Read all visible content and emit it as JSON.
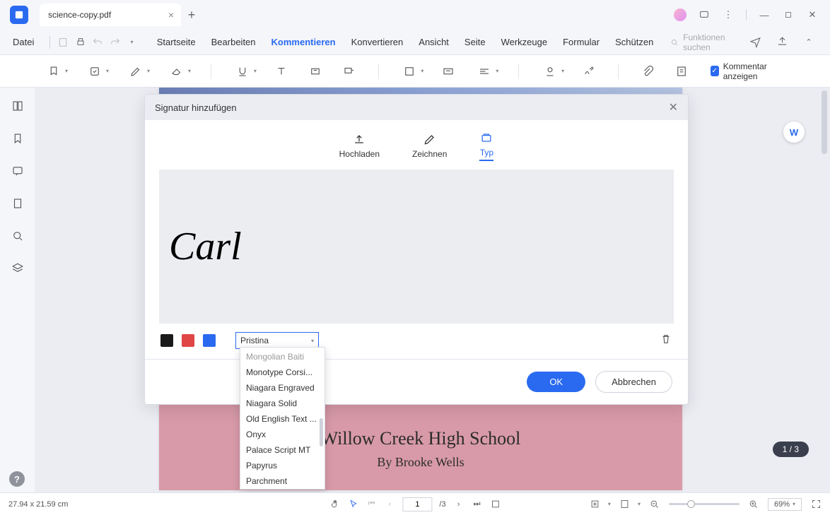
{
  "titlebar": {
    "tab_title": "science-copy.pdf"
  },
  "menu": {
    "file": "Datei",
    "items": [
      "Startseite",
      "Bearbeiten",
      "Kommentieren",
      "Konvertieren",
      "Ansicht",
      "Seite",
      "Werkzeuge",
      "Formular",
      "Schützen"
    ],
    "active_index": 2,
    "search_placeholder": "Funktionen suchen"
  },
  "toolbar": {
    "comment_label": "Kommentar anzeigen",
    "comment_checked": true
  },
  "dialog": {
    "title": "Signatur hinzufügen",
    "tabs": {
      "upload": "Hochladen",
      "draw": "Zeichnen",
      "type": "Typ"
    },
    "signature_text": "Carl",
    "font_selected": "Pristina",
    "font_options": [
      "Mongolian Baiti",
      "Monotype Corsi...",
      "Niagara Engraved",
      "Niagara Solid",
      "Old English Text ...",
      "Onyx",
      "Palace Script MT",
      "Papyrus",
      "Parchment"
    ],
    "ok": "OK",
    "cancel": "Abbrechen",
    "colors": {
      "black": "#1a1a1a",
      "red": "#e04646",
      "blue": "#2a6af0"
    }
  },
  "document": {
    "title": "Willow Creek High School",
    "subtitle": "By Brooke Wells",
    "page_indicator": "1 / 3"
  },
  "status": {
    "dimensions": "27.94 x 21.59 cm",
    "page_current": "1",
    "page_total": "/3",
    "zoom": "69%"
  }
}
